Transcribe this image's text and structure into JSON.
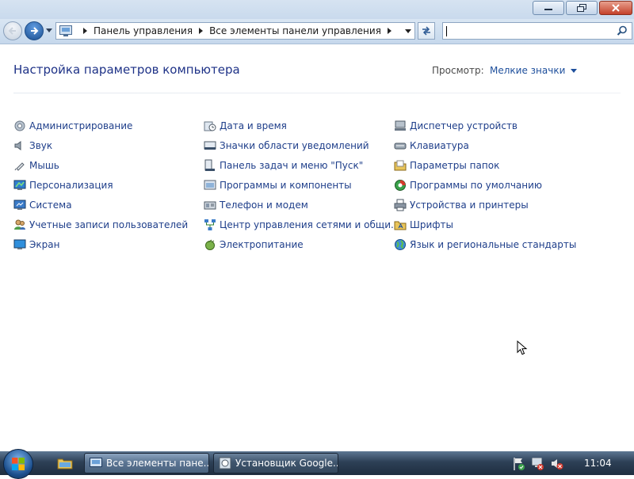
{
  "window": {
    "minimize_icon": "minimize-icon",
    "maximize_icon": "restore-icon",
    "close_icon": "close-icon"
  },
  "navigation": {
    "breadcrumb": [
      "Панель управления",
      "Все элементы панели управления"
    ],
    "search_placeholder": ""
  },
  "header": {
    "title": "Настройка параметров компьютера",
    "view_label": "Просмотр:",
    "view_value": "Мелкие значки"
  },
  "columns": [
    [
      {
        "label": "Администрирование",
        "icon": "admin-tools-icon"
      },
      {
        "label": "Звук",
        "icon": "speaker-icon"
      },
      {
        "label": "Мышь",
        "icon": "mouse-icon"
      },
      {
        "label": "Персонализация",
        "icon": "personalization-icon"
      },
      {
        "label": "Система",
        "icon": "system-icon"
      },
      {
        "label": "Учетные записи пользователей",
        "icon": "users-icon"
      },
      {
        "label": "Экран",
        "icon": "display-icon"
      }
    ],
    [
      {
        "label": "Дата и время",
        "icon": "clock-icon"
      },
      {
        "label": "Значки области уведомлений",
        "icon": "tray-icon"
      },
      {
        "label": "Панель задач и меню \"Пуск\"",
        "icon": "taskbar-icon"
      },
      {
        "label": "Программы и компоненты",
        "icon": "programs-icon"
      },
      {
        "label": "Телефон и модем",
        "icon": "modem-icon"
      },
      {
        "label": "Центр управления сетями и общи...",
        "icon": "network-icon"
      },
      {
        "label": "Электропитание",
        "icon": "power-icon"
      }
    ],
    [
      {
        "label": "Диспетчер устройств",
        "icon": "device-manager-icon"
      },
      {
        "label": "Клавиатура",
        "icon": "keyboard-icon"
      },
      {
        "label": "Параметры папок",
        "icon": "folder-options-icon"
      },
      {
        "label": "Программы по умолчанию",
        "icon": "default-programs-icon"
      },
      {
        "label": "Устройства и принтеры",
        "icon": "printer-icon"
      },
      {
        "label": "Шрифты",
        "icon": "fonts-icon"
      },
      {
        "label": "Язык и региональные стандарты",
        "icon": "globe-icon"
      }
    ]
  ],
  "taskbar": {
    "tasks": [
      {
        "label": "Все элементы пане...",
        "active": true
      },
      {
        "label": "Установщик Google...",
        "active": false
      }
    ],
    "clock": "11:04"
  }
}
